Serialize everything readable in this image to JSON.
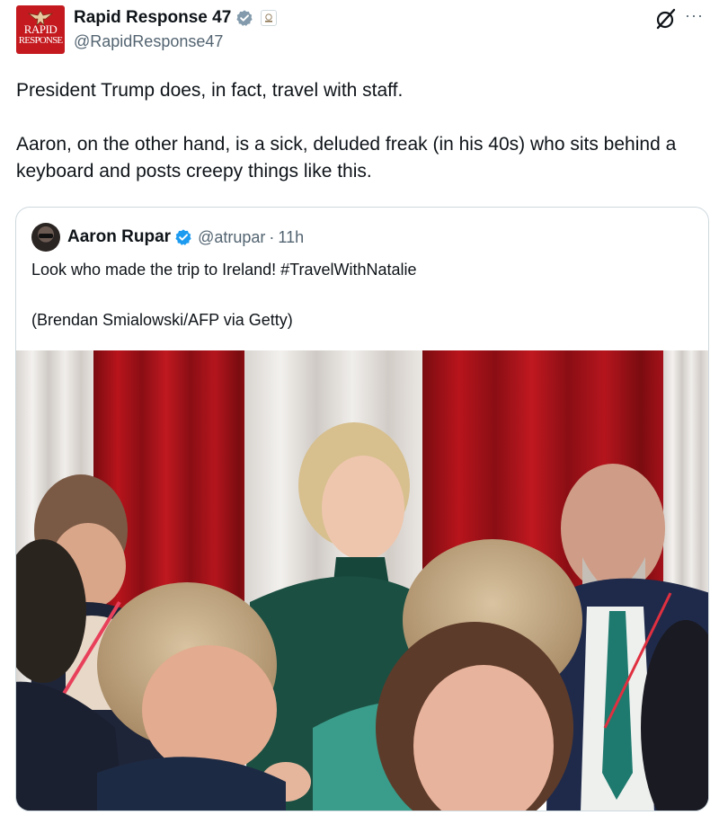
{
  "post": {
    "author": {
      "display_name": "Rapid Response 47",
      "handle": "@RapidResponse47",
      "avatar_line1": "RAPID",
      "avatar_line2": "RESPONSE"
    },
    "text_line1": "President Trump does, in fact, travel with staff.",
    "text_line2": "Aaron, on the other hand, is a sick, deluded freak (in his 40s) who sits behind a keyboard and posts creepy things like this.",
    "actions": {
      "grok_icon": "grok-icon",
      "more_icon": "more-icon",
      "more_glyph": "···"
    }
  },
  "quoted_post": {
    "author": {
      "display_name": "Aaron Rupar",
      "handle": "@atrupar",
      "separator": "·",
      "time": "11h"
    },
    "text_line1": "Look who made the trip to Ireland! #TravelWithNatalie",
    "text_line2": "(Brendan Smialowski/AFP via Getty)",
    "image_alt": "Photo of people at an event in front of red and white curtains"
  },
  "colors": {
    "text_primary": "#0f1419",
    "text_secondary": "#536471",
    "verified_blue": "#1d9bf0",
    "verified_gray": "#829aab",
    "brand_red": "#c41a1f",
    "border": "#cfd9de"
  }
}
